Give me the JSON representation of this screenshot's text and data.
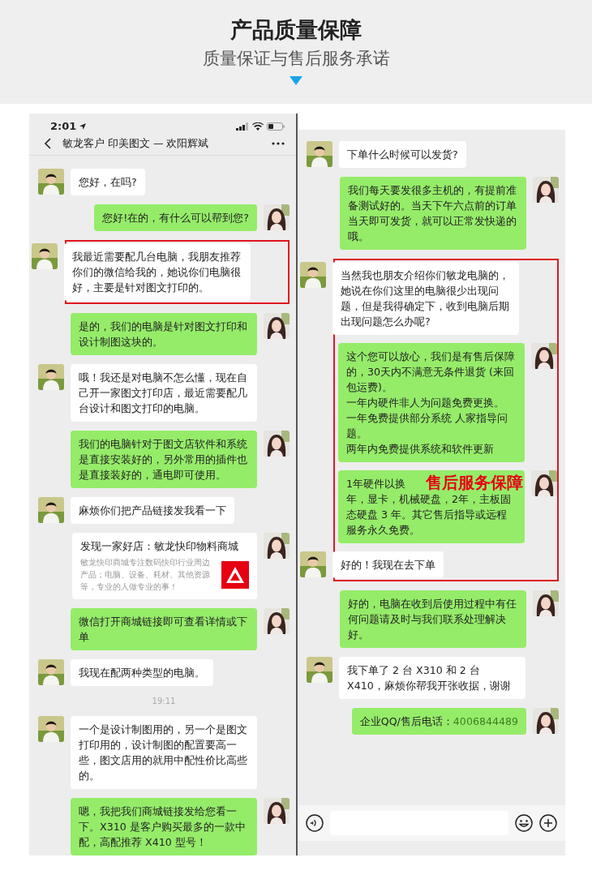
{
  "header": {
    "title": "产品质量保障",
    "subtitle": "质量保证与售后服务承诺"
  },
  "left_chat": {
    "status_bar": {
      "time": "2:01"
    },
    "nav": {
      "title": "敏龙客户 印美图文 — 欢阳辉斌"
    },
    "items": [
      {
        "kind": "in",
        "text": "您好，在吗?"
      },
      {
        "kind": "out",
        "text": "您好!在的，有什么可以帮到您?"
      },
      {
        "kind": "highlight",
        "messages": [
          {
            "kind": "in",
            "text": "我最近需要配几台电脑，我朋友推荐你们的微信给我的，她说你们电脑很好，主要是针对图文打印的。"
          }
        ]
      },
      {
        "kind": "out",
        "text": "是的，我们的电脑是针对图文打印和设计制图这块的。"
      },
      {
        "kind": "in",
        "text": "哦！我还是对电脑不怎么懂，现在自己开一家图文打印店，最近需要配几台设计和图文打印的电脑。"
      },
      {
        "kind": "out",
        "text": "我们的电脑针对于图文店软件和系统是直接安装好的，另外常用的插件也是直接装好的，通电即可使用。"
      },
      {
        "kind": "in",
        "text": "麻烦你们把产品链接发我看一下"
      },
      {
        "kind": "card",
        "title": "发现一家好店：敏龙快印物料商城",
        "description": "敏龙快印商城专注数码快印行业周边产品；电脑、设备、耗材、其他资源等，专业的人做专业的事！"
      },
      {
        "kind": "out",
        "text": "微信打开商城链接即可查看详情或下单"
      },
      {
        "kind": "in",
        "text": "我现在配两种类型的电脑。"
      },
      {
        "kind": "time",
        "text": "19:11"
      },
      {
        "kind": "in",
        "text": "一个是设计制图用的，另一个是图文打印用的，设计制图的配置要高一些，图文店用的就用中配性价比高些的。"
      },
      {
        "kind": "out",
        "text": "嗯，我把我们商城链接发给您看一下。X310 是客户购买最多的一款中配，高配推荐 X410 型号！"
      }
    ]
  },
  "right_chat": {
    "items": [
      {
        "kind": "in",
        "text": "下单什么时候可以发货?"
      },
      {
        "kind": "out",
        "text": "我们每天要发很多主机的，有提前准备测试好的。当天下午六点前的订单当天即可发货，就可以正常发快递的哦。"
      },
      {
        "kind": "highlight",
        "messages": [
          {
            "kind": "in",
            "text": "当然我也朋友介绍你们敏龙电脑的，她说在你们这里的电脑很少出现问题，但是我得确定下，收到电脑后期出现问题怎么办呢?"
          },
          {
            "kind": "out",
            "lines": [
              "这个您可以放心，我们是有售后保障的，30天内不满意无条件退货 (来回包运费)。",
              "一年内硬件非人为问题免费更换。",
              "一年免费提供部分系统 人家指导问题。",
              "两年内免费提供系统和软件更新"
            ]
          },
          {
            "kind": "out",
            "lines": [
              "1年硬件以换",
              "年，显卡，机械硬盘，2年，主板固态硬盘 3 年。其它售后指导或远程服务永久免费。"
            ],
            "annotation": "售后服务保障"
          },
          {
            "kind": "in",
            "text": "好的！我现在去下单"
          }
        ]
      },
      {
        "kind": "out",
        "text": "好的，电脑在收到后使用过程中有任何问题请及时与我们联系处理解决好。"
      },
      {
        "kind": "in",
        "text": "我下单了 2 台 X310 和 2 台 X410，麻烦你帮我开张收据，谢谢"
      },
      {
        "kind": "out",
        "text": "企业QQ/售后电话：",
        "link": "4006844489"
      }
    ]
  }
}
